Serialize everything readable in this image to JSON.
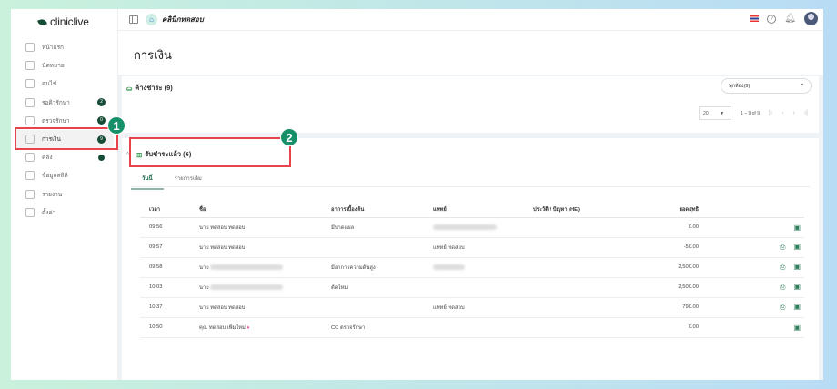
{
  "brand": "cliniclive",
  "clinic_name": "คลินิกทดสอบ",
  "sidebar": {
    "items": [
      {
        "label": "หน้าแรก",
        "badge": null
      },
      {
        "label": "นัดหมาย",
        "badge": null
      },
      {
        "label": "คนไข้",
        "badge": null
      },
      {
        "label": "รอคิวรักษา",
        "badge": "2"
      },
      {
        "label": "ตรวจรักษา",
        "badge": "0"
      },
      {
        "label": "การเงิน",
        "badge": "9"
      },
      {
        "label": "คลัง",
        "badge": ""
      },
      {
        "label": "ข้อมูลสถิติ",
        "badge": null
      },
      {
        "label": "รายงาน",
        "badge": null
      },
      {
        "label": "ตั้งค่า",
        "badge": null
      }
    ]
  },
  "callouts": [
    "1",
    "2"
  ],
  "page_title": "การเงิน",
  "pending": {
    "title": "ค้างชำระ (9)",
    "room_filter": "ทุกห้อง(9)",
    "page_size": "20",
    "range": "1 – 9 of 9"
  },
  "paid": {
    "title": "รับชำระแล้ว (6)",
    "tabs": [
      "วันนี้",
      "รายการเดิม"
    ],
    "columns": [
      "เวลา",
      "ชื่อ",
      "อาการเบื้องต้น",
      "แพทย์",
      "ประวัติ / ปัญหา (HE)",
      "ยอดสุทธิ"
    ],
    "rows": [
      {
        "time": "09:56",
        "name": "นาย ทดสอบ ทดสอบ",
        "symptom": "มีบาดแผล",
        "doctor": "",
        "he": "",
        "total": "0.00",
        "print": false
      },
      {
        "time": "09:57",
        "name": "นาย ทดสอบ ทดสอบ",
        "symptom": "",
        "doctor": "แพทย์ ทดสอบ",
        "he": "",
        "total": "-50.00",
        "print": true
      },
      {
        "time": "09:58",
        "name": "นาย",
        "symptom": "มีอาการความดันสูง",
        "doctor": "",
        "he": "",
        "total": "2,500.00",
        "print": true
      },
      {
        "time": "10:03",
        "name": "นาย",
        "symptom": "ตัดไหม",
        "doctor": "",
        "he": "",
        "total": "2,500.00",
        "print": true
      },
      {
        "time": "10:37",
        "name": "นาย ทดสอบ ทดสอบ",
        "symptom": "",
        "doctor": "แพทย์ ทดสอบ",
        "he": "",
        "total": "790.00",
        "print": true
      },
      {
        "time": "10:50",
        "name": "คุณ ทดสอบ เพิ่มใหม่",
        "symptom": "CC ตรวจรักษา",
        "doctor": "",
        "he": "",
        "total": "0.00",
        "print": false
      }
    ]
  }
}
